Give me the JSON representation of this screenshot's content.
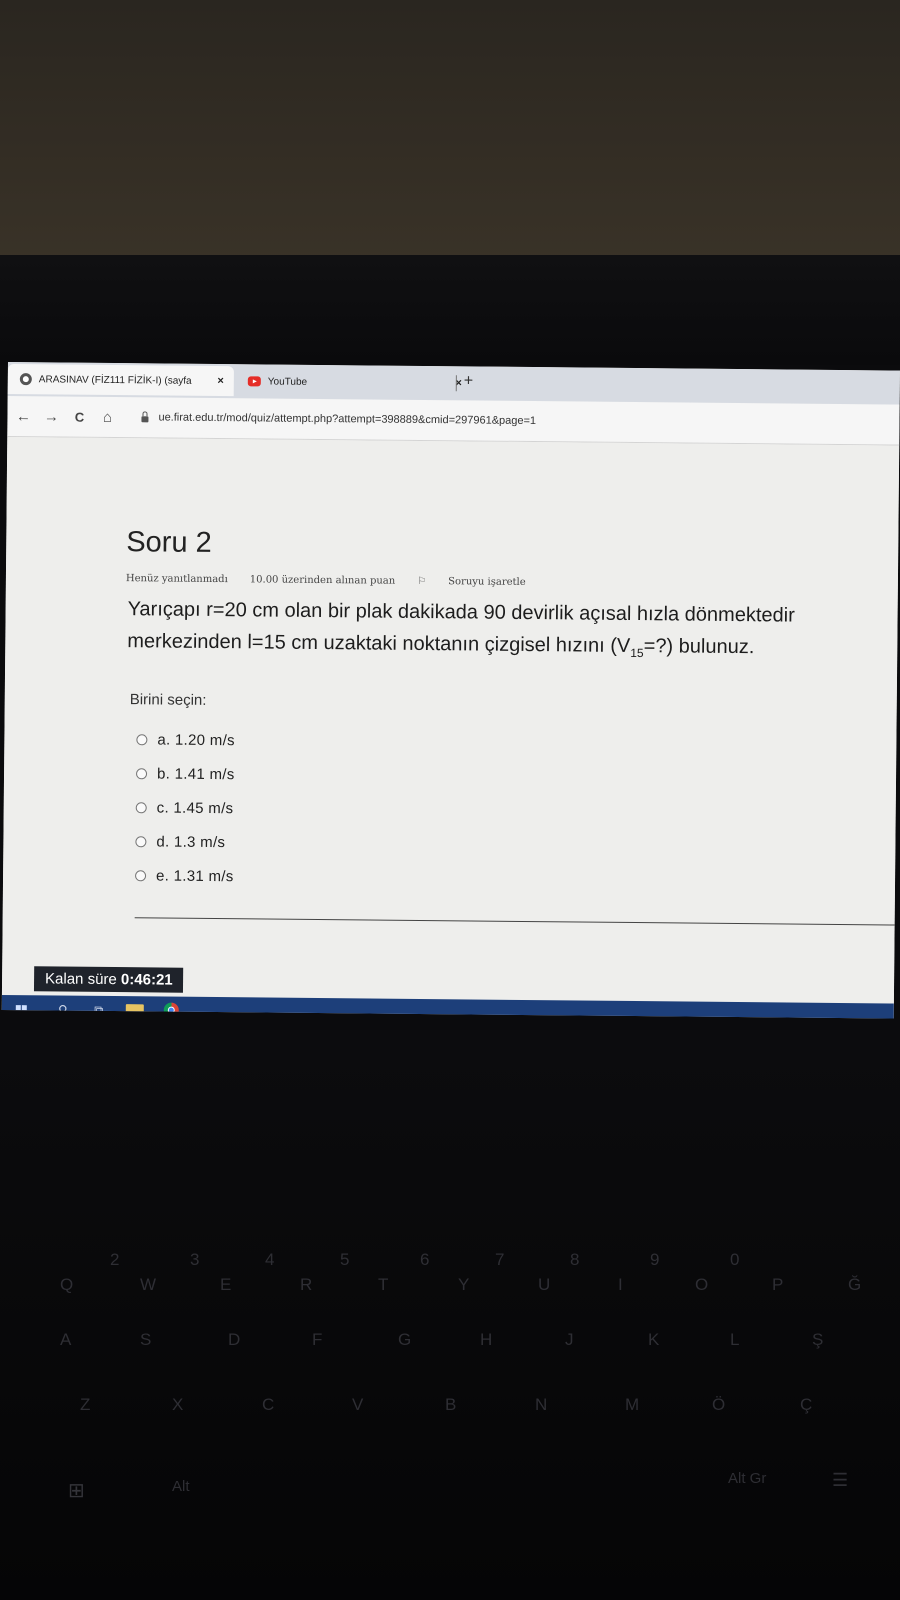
{
  "browser": {
    "tabs": [
      {
        "label": "ARASINAV (FİZ111 FİZİK-I) (sayfa",
        "close": "×",
        "active": true
      },
      {
        "label": "YouTube",
        "close": "×",
        "active": false
      }
    ],
    "new_tab": "+",
    "nav": {
      "back": "←",
      "forward": "→",
      "reload": "C",
      "home": "⌂"
    },
    "url": "ue.firat.edu.tr/mod/quiz/attempt.php?attempt=398889&cmid=297961&page=1"
  },
  "question": {
    "title": "Soru 2",
    "status": "Henüz yanıtlanmadı",
    "points": "10.00 üzerinden alınan puan",
    "flag_label": "Soruyu işaretle",
    "line1": "Yarıçapı r=20 cm olan bir plak dakikada 90 devirlik açısal hızla dönmektedir",
    "line2_a": "merkezinden l=15 cm  uzaktaki noktanın çizgisel hızını (V",
    "line2_sub": "15",
    "line2_b": "=?) bulunuz.",
    "prompt": "Birini seçin:",
    "options": [
      {
        "label": "a. 1.20 m/s"
      },
      {
        "label": "b. 1.41 m/s"
      },
      {
        "label": "c. 1.45 m/s"
      },
      {
        "label": "d. 1.3 m/s"
      },
      {
        "label": "e. 1.31 m/s"
      }
    ]
  },
  "timer": {
    "label": "Kalan süre ",
    "value": "0:46:21"
  },
  "taskbar": {
    "icons": [
      "windows-icon",
      "search-icon",
      "task-view-icon",
      "file-explorer-icon",
      "chrome-icon"
    ]
  },
  "keyboard": {
    "row_numbers": [
      "2",
      "3",
      "4",
      "5",
      "6",
      "7",
      "8",
      "9",
      "0"
    ],
    "row_q": [
      "Q",
      "W",
      "E",
      "R",
      "T",
      "Y",
      "U",
      "I",
      "O",
      "P",
      "Ğ"
    ],
    "row_a": [
      "A",
      "S",
      "D",
      "F",
      "G",
      "H",
      "J",
      "K",
      "L",
      "Ş"
    ],
    "row_z": [
      "Z",
      "X",
      "C",
      "V",
      "B",
      "N",
      "M",
      "Ö",
      "Ç"
    ],
    "alt": "Alt",
    "altgr": "Alt Gr"
  }
}
